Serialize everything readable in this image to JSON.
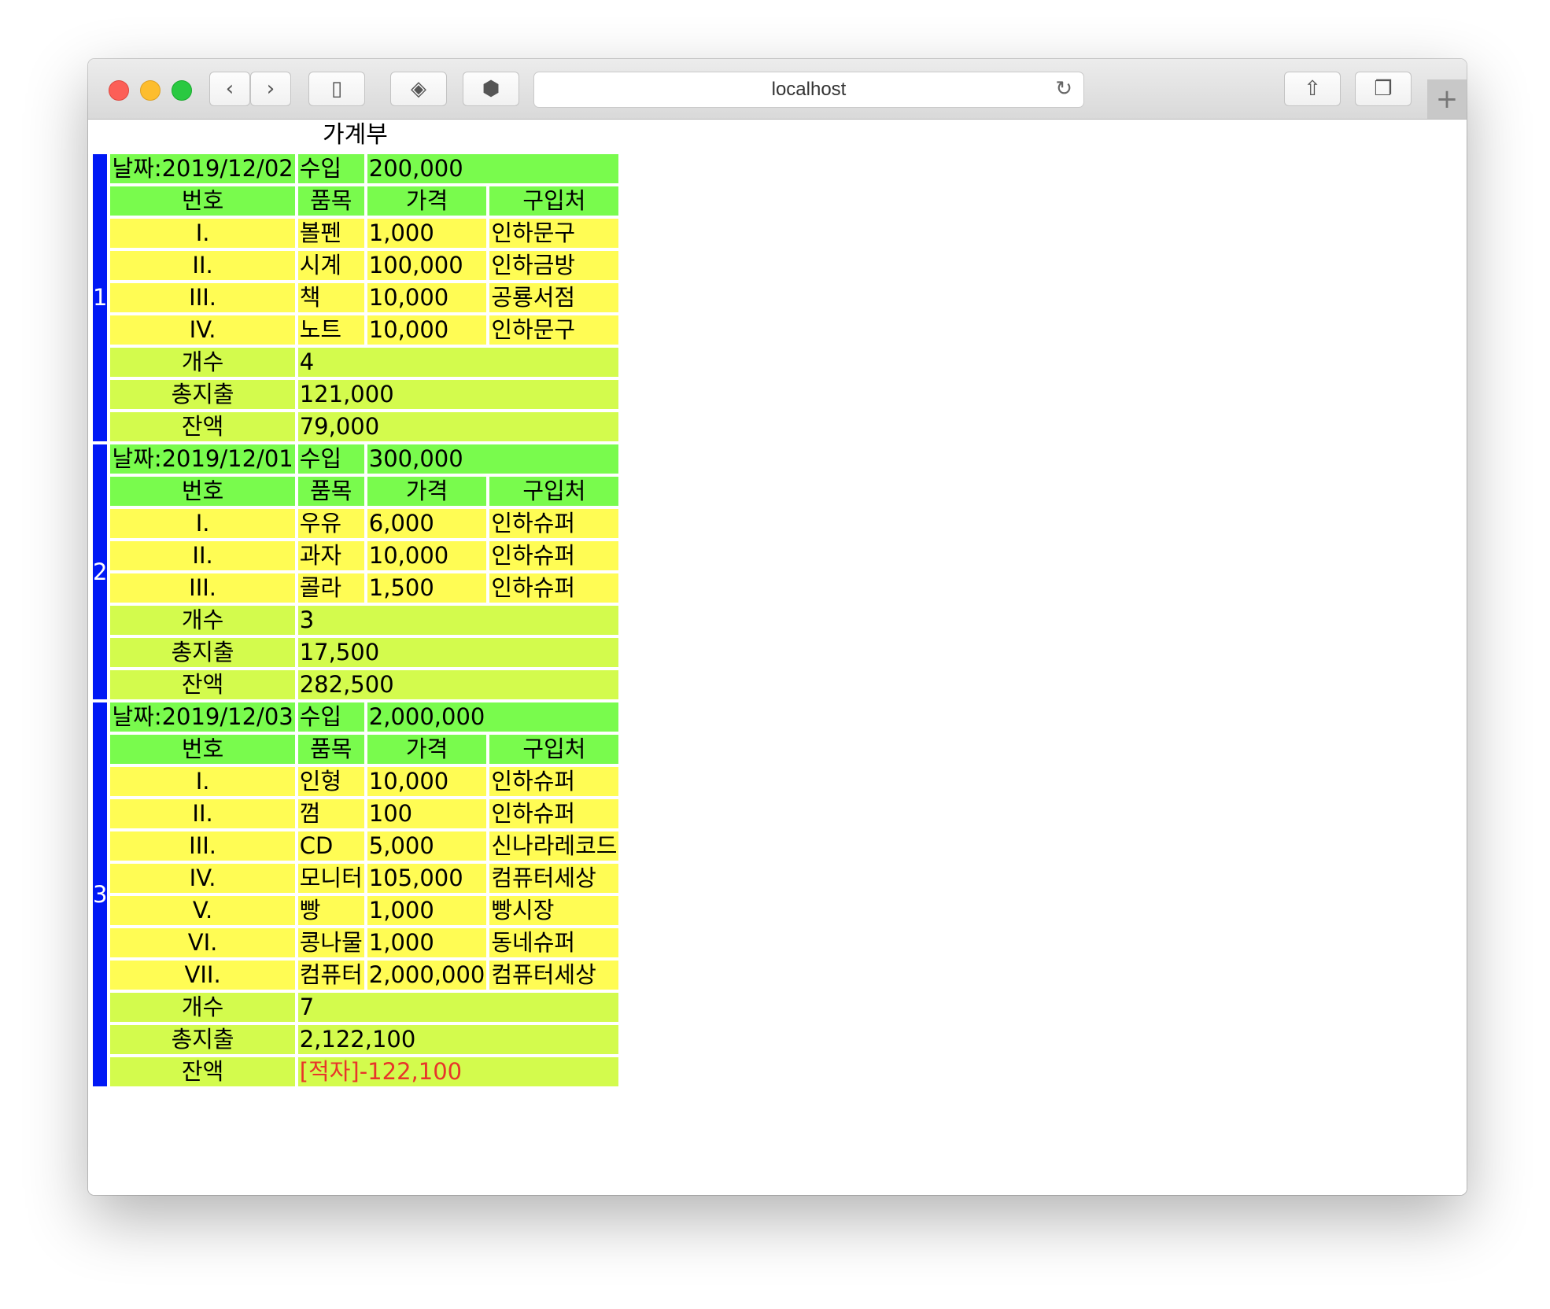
{
  "browser": {
    "address": "localhost"
  },
  "page": {
    "title": "가계부"
  },
  "labels": {
    "income": "수입",
    "col_number": "번호",
    "col_item": "품목",
    "col_price": "가격",
    "col_store": "구입처",
    "count": "개수",
    "total_expense": "총지출",
    "balance": "잔액"
  },
  "groups": [
    {
      "index": "1",
      "date": "날짜:2019/12/02",
      "income": "200,000",
      "items": [
        {
          "no": "I.",
          "item": "볼펜",
          "price": "1,000",
          "store": "인하문구"
        },
        {
          "no": "II.",
          "item": "시계",
          "price": "100,000",
          "store": "인하금방"
        },
        {
          "no": "III.",
          "item": "책",
          "price": "10,000",
          "store": "공룡서점"
        },
        {
          "no": "IV.",
          "item": "노트",
          "price": "10,000",
          "store": "인하문구"
        }
      ],
      "count": "4",
      "total_expense": "121,000",
      "balance": "79,000",
      "deficit": false
    },
    {
      "index": "2",
      "date": "날짜:2019/12/01",
      "income": "300,000",
      "items": [
        {
          "no": "I.",
          "item": "우유",
          "price": "6,000",
          "store": "인하슈퍼"
        },
        {
          "no": "II.",
          "item": "과자",
          "price": "10,000",
          "store": "인하슈퍼"
        },
        {
          "no": "III.",
          "item": "콜라",
          "price": "1,500",
          "store": "인하슈퍼"
        }
      ],
      "count": "3",
      "total_expense": "17,500",
      "balance": "282,500",
      "deficit": false
    },
    {
      "index": "3",
      "date": "날짜:2019/12/03",
      "income": "2,000,000",
      "items": [
        {
          "no": "I.",
          "item": "인형",
          "price": "10,000",
          "store": "인하슈퍼"
        },
        {
          "no": "II.",
          "item": "껌",
          "price": "100",
          "store": "인하슈퍼"
        },
        {
          "no": "III.",
          "item": "CD",
          "price": "5,000",
          "store": "신나라레코드"
        },
        {
          "no": "IV.",
          "item": "모니터",
          "price": "105,000",
          "store": "컴퓨터세상"
        },
        {
          "no": "V.",
          "item": "빵",
          "price": "1,000",
          "store": "빵시장"
        },
        {
          "no": "VI.",
          "item": "콩나물",
          "price": "1,000",
          "store": "동네슈퍼"
        },
        {
          "no": "VII.",
          "item": "컴퓨터",
          "price": "2,000,000",
          "store": "컴퓨터세상"
        }
      ],
      "count": "7",
      "total_expense": "2,122,100",
      "balance": "[적자]-122,100",
      "deficit": true
    }
  ],
  "colors": {
    "index_bar": "#0018f5",
    "header_green": "#79fb4d",
    "item_yellow": "#fffc54",
    "summary_lime": "#d3fb4d",
    "deficit_red": "#e8352a"
  }
}
